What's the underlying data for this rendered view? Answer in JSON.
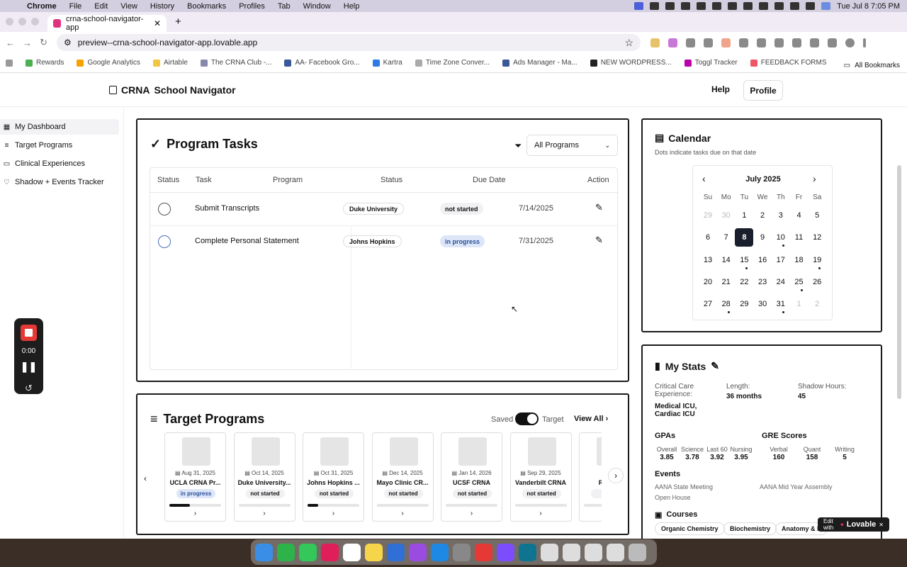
{
  "mac_menu": {
    "app": "Chrome",
    "items": [
      "File",
      "Edit",
      "View",
      "History",
      "Bookmarks",
      "Profiles",
      "Tab",
      "Window",
      "Help"
    ],
    "clock": "Tue Jul 8  7:05 PM"
  },
  "browser": {
    "tab_title": "crna-school-navigator-app",
    "url": "preview--crna-school-navigator-app.lovable.app",
    "bookmarks": [
      "Rewards",
      "Google Analytics",
      "Airtable",
      "The CRNA Club -...",
      "AA- Facebook Gro...",
      "Kartra",
      "Time Zone Conver...",
      "Ads Manager - Ma...",
      "NEW WORDPRESS...",
      "Toggl Tracker",
      "FEEDBACK FORMS"
    ],
    "all_bookmarks": "All Bookmarks"
  },
  "app": {
    "brand_a": "CRNA",
    "brand_b": "School Navigator",
    "help": "Help",
    "profile": "Profile"
  },
  "sidebar": {
    "items": [
      {
        "label": "My Dashboard",
        "icon": "grid-icon"
      },
      {
        "label": "Target Programs",
        "icon": "list-icon"
      },
      {
        "label": "Clinical Experiences",
        "icon": "monitor-icon"
      },
      {
        "label": "Shadow + Events Tracker",
        "icon": "heart-icon"
      }
    ]
  },
  "tasks": {
    "title": "Program Tasks",
    "filter": "All Programs",
    "headers": [
      "Status",
      "Task",
      "Program",
      "Status",
      "Due Date",
      "Action"
    ],
    "rows": [
      {
        "task": "Submit Transcripts",
        "program": "Duke University",
        "status": "not started",
        "due": "7/14/2025"
      },
      {
        "task": "Complete Personal Statement",
        "program": "Johns Hopkins",
        "status": "in progress",
        "due": "7/31/2025"
      }
    ]
  },
  "targets": {
    "title": "Target Programs",
    "saved": "Saved",
    "target": "Target",
    "view_all": "View All",
    "programs": [
      {
        "date": "Aug 31, 2025",
        "name": "UCLA CRNA Pr...",
        "status": "in progress",
        "progress": 0.4
      },
      {
        "date": "Oct 14, 2025",
        "name": "Duke University...",
        "status": "not started",
        "progress": 0
      },
      {
        "date": "Oct 31, 2025",
        "name": "Johns Hopkins ...",
        "status": "not started",
        "progress": 0.2
      },
      {
        "date": "Dec 14, 2025",
        "name": "Mayo Clinic CR...",
        "status": "not started",
        "progress": 0
      },
      {
        "date": "Jan 14, 2026",
        "name": "UCSF CRNA",
        "status": "not started",
        "progress": 0
      },
      {
        "date": "Sep 29, 2025",
        "name": "Vanderbilt CRNA",
        "status": "not started",
        "progress": 0
      },
      {
        "date": "O",
        "name": "Rush U",
        "status": "no",
        "progress": 0
      }
    ]
  },
  "calendar": {
    "title": "Calendar",
    "subtitle": "Dots indicate tasks due on that date",
    "month": "July 2025",
    "dow": [
      "Su",
      "Mo",
      "Tu",
      "We",
      "Th",
      "Fr",
      "Sa"
    ],
    "weeks": [
      [
        "29",
        "30",
        "1",
        "2",
        "3",
        "4",
        "5"
      ],
      [
        "6",
        "7",
        "8",
        "9",
        "10",
        "11",
        "12"
      ],
      [
        "13",
        "14",
        "15",
        "16",
        "17",
        "18",
        "19"
      ],
      [
        "20",
        "21",
        "22",
        "23",
        "24",
        "25",
        "26"
      ],
      [
        "27",
        "28",
        "29",
        "30",
        "31",
        "1",
        "2"
      ]
    ],
    "selected": "8",
    "dot_days": [
      "10",
      "15",
      "19",
      "25",
      "28",
      "31"
    ]
  },
  "stats": {
    "title": "My Stats",
    "cc_label": "Critical Care Experience:",
    "cc_value": "Medical ICU, Cardiac ICU",
    "length_label": "Length:",
    "length_value": "36 months",
    "shadow_label": "Shadow Hours:",
    "shadow_value": "45",
    "gpa_title": "GPAs",
    "gpas": [
      {
        "l": "Overall",
        "v": "3.85"
      },
      {
        "l": "Science",
        "v": "3.78"
      },
      {
        "l": "Last 60",
        "v": "3.92"
      },
      {
        "l": "Nursing",
        "v": "3.95"
      }
    ],
    "gre_title": "GRE Scores",
    "gre": [
      {
        "l": "Verbal",
        "v": "160"
      },
      {
        "l": "Quant",
        "v": "158"
      },
      {
        "l": "Writing",
        "v": "5"
      }
    ],
    "events_title": "Events",
    "events": [
      "AANA State Meeting",
      "AANA Mid Year Assembly",
      "Open House"
    ],
    "courses_title": "Courses",
    "courses": [
      "Organic Chemistry",
      "Biochemistry",
      "Anatomy & P"
    ]
  },
  "lovable": {
    "edit": "Edit with",
    "brand": "Lovable"
  },
  "recorder": {
    "time": "0:00"
  }
}
